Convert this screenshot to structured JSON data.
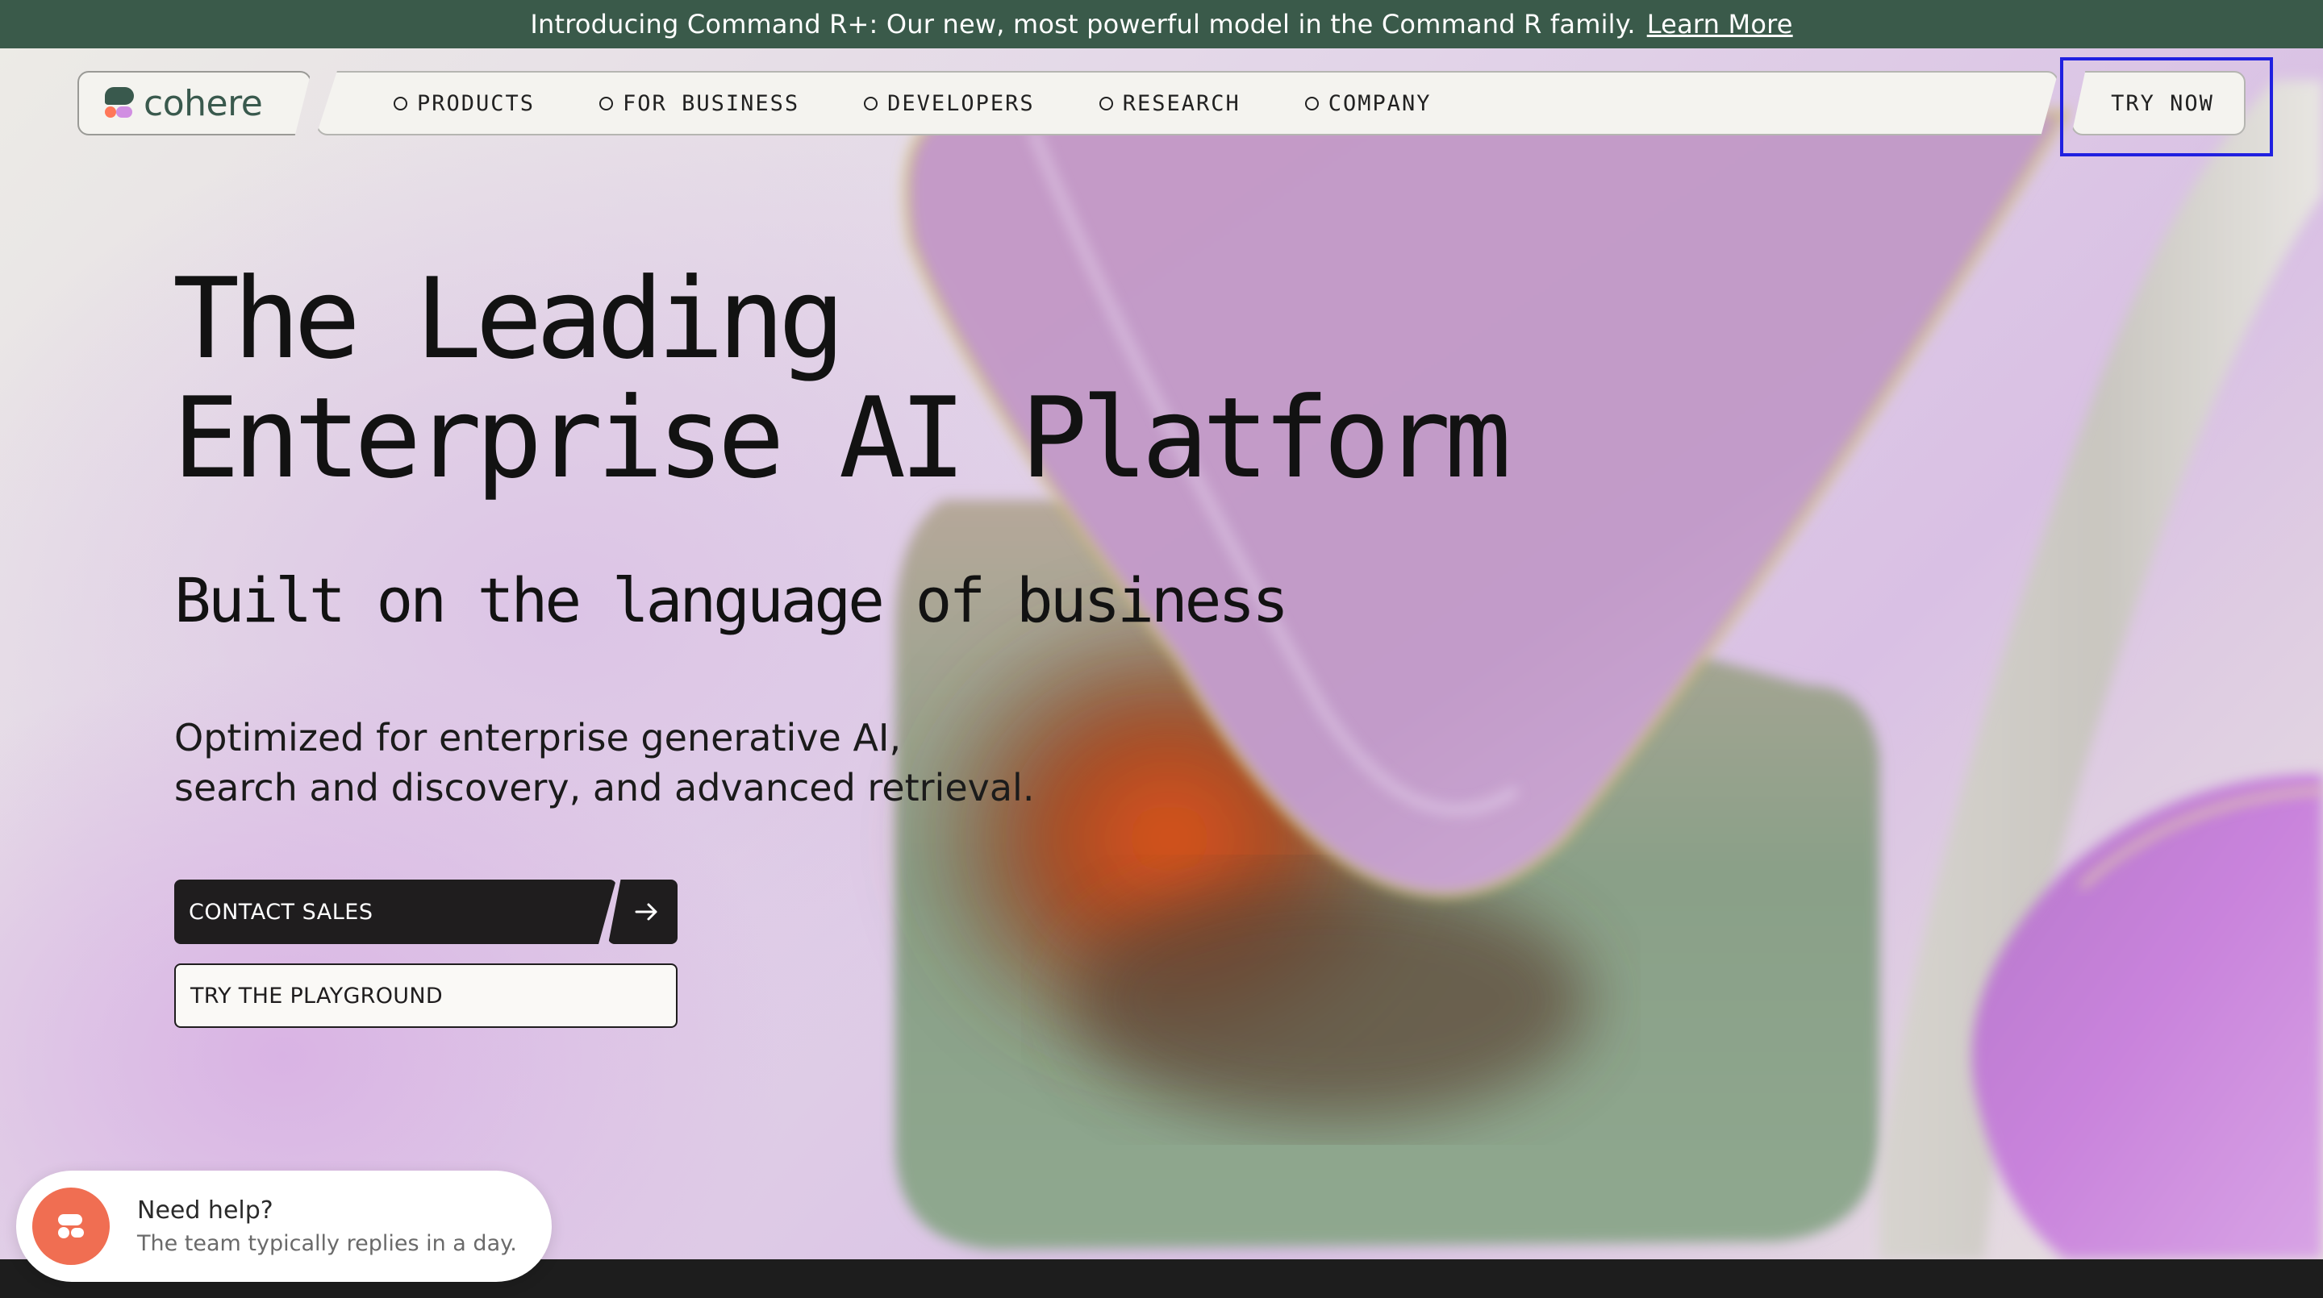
{
  "announcement": {
    "text": "Introducing Command R+: Our new, most powerful model in the Command R family.",
    "link_label": "Learn More"
  },
  "brand": {
    "name": "cohere",
    "colors": {
      "green": "#39594d",
      "coral": "#ff7759",
      "lilac": "#d18ee2"
    }
  },
  "nav": {
    "items": [
      {
        "label": "PRODUCTS"
      },
      {
        "label": "FOR BUSINESS"
      },
      {
        "label": "DEVELOPERS"
      },
      {
        "label": "RESEARCH"
      },
      {
        "label": "COMPANY"
      }
    ],
    "cta_label": "TRY NOW"
  },
  "hero": {
    "headline_line1": "The Leading",
    "headline_line2": "Enterprise AI Platform",
    "subheadline": "Built on the language of business",
    "description_line1": "Optimized for enterprise generative AI,",
    "description_line2": "search and discovery, and advanced retrieval.",
    "primary_cta": "CONTACT SALES",
    "secondary_cta": "TRY THE PLAYGROUND"
  },
  "help_widget": {
    "title": "Need help?",
    "subtitle": "The team typically replies in a day."
  }
}
